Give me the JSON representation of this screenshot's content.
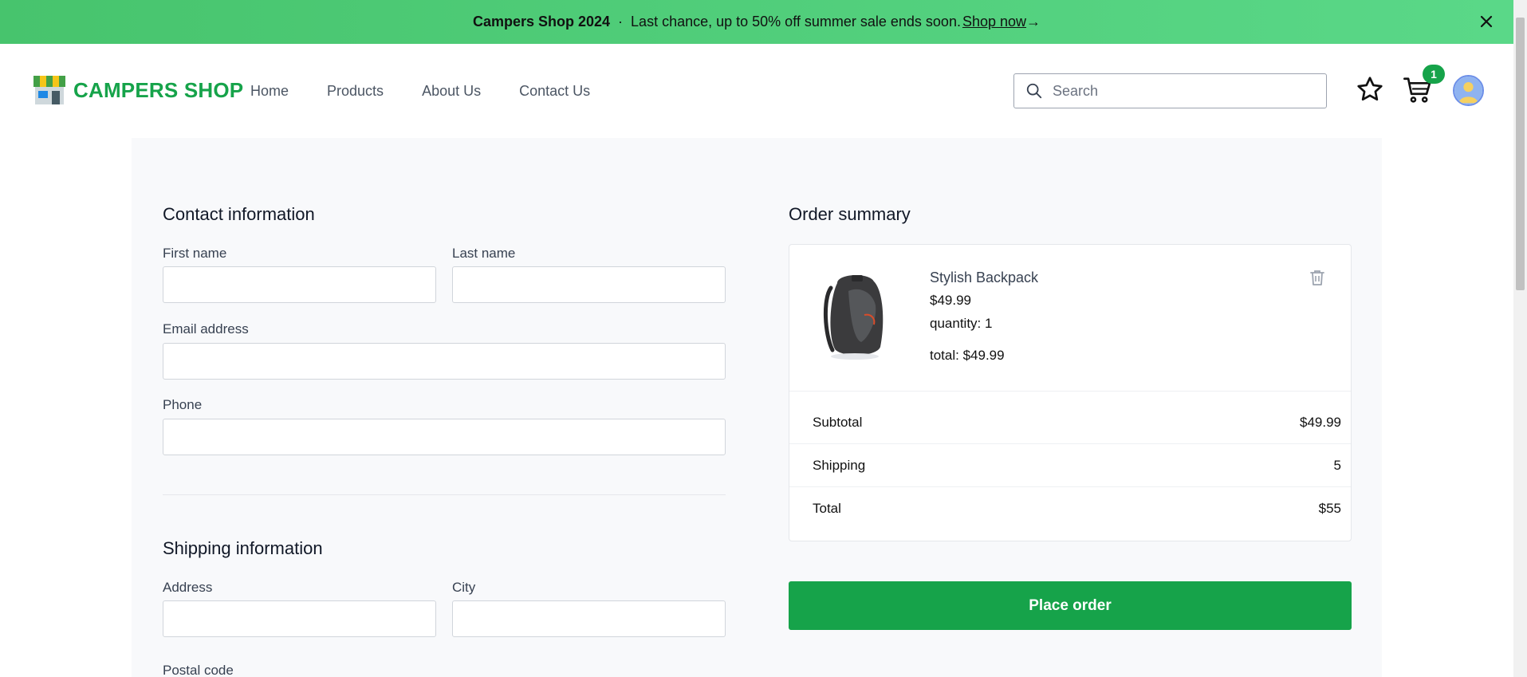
{
  "banner": {
    "brand": "Campers Shop 2024",
    "separator": "·",
    "message": "Last chance, up to 50% off summer sale ends soon.",
    "link": " Shop now",
    "arrow": "→"
  },
  "header": {
    "logo_text": "CAMPERS SHOP",
    "nav": [
      "Home",
      "Products",
      "About Us",
      "Contact Us"
    ],
    "search_placeholder": "Search",
    "cart_count": "1"
  },
  "contact": {
    "title": "Contact information",
    "first_name_label": "First name",
    "last_name_label": "Last name",
    "email_label": "Email address",
    "phone_label": "Phone",
    "first_name_value": "",
    "last_name_value": "",
    "email_value": "",
    "phone_value": ""
  },
  "shipping": {
    "title": "Shipping information",
    "address_label": "Address",
    "city_label": "City",
    "postal_label": "Postal code",
    "address_value": "",
    "city_value": ""
  },
  "summary": {
    "title": "Order summary",
    "item": {
      "name": "Stylish Backpack",
      "price": "$49.99",
      "quantity": "quantity: 1",
      "total": "total: $49.99"
    },
    "subtotal_label": "Subtotal",
    "subtotal_value": "$49.99",
    "shipping_label": "Shipping",
    "shipping_value": "5",
    "total_label": "Total",
    "total_value": "$55",
    "button": "Place order"
  },
  "colors": {
    "brand_green": "#16a34a",
    "banner_green": "#4fce78",
    "panel_bg": "#f8f9fb"
  },
  "icons": [
    "close-icon",
    "store-icon",
    "search-icon",
    "star-icon",
    "cart-icon",
    "avatar-icon",
    "trash-icon"
  ]
}
